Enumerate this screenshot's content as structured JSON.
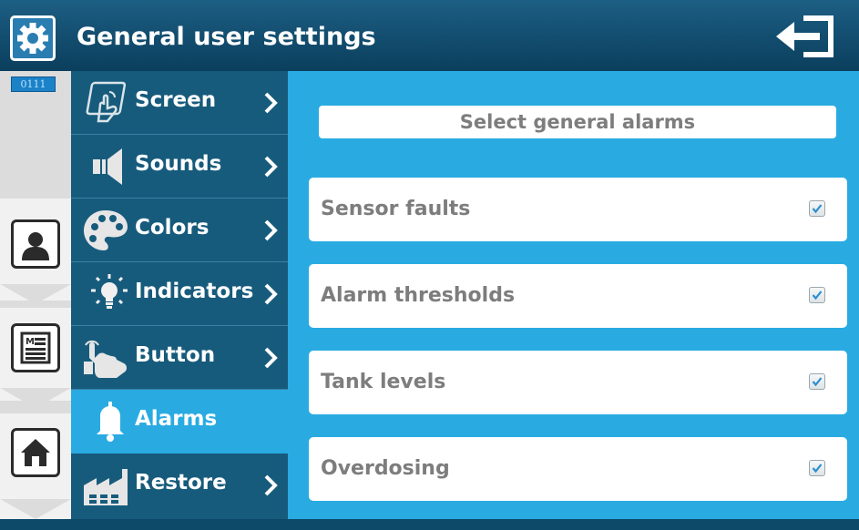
{
  "header": {
    "title": "General user settings",
    "settings_icon": "gear-icon",
    "exit_icon": "exit-icon"
  },
  "sidebar": {
    "badge": "0111",
    "buttons": [
      {
        "name": "user-profile-button",
        "icon": "person-icon"
      },
      {
        "name": "recipe-button",
        "icon": "document-list-icon"
      },
      {
        "name": "home-button",
        "icon": "home-icon"
      }
    ]
  },
  "menu": {
    "items": [
      {
        "label": "Screen",
        "icon": "touch-screen-icon",
        "active": false
      },
      {
        "label": "Sounds",
        "icon": "speaker-icon",
        "active": false
      },
      {
        "label": "Colors",
        "icon": "palette-icon",
        "active": false
      },
      {
        "label": "Indicators",
        "icon": "lightbulb-icon",
        "active": false
      },
      {
        "label": "Button",
        "icon": "hand-press-icon",
        "active": false
      },
      {
        "label": "Alarms",
        "icon": "bell-icon",
        "active": true
      },
      {
        "label": "Restore",
        "icon": "factory-icon",
        "active": false
      }
    ]
  },
  "main": {
    "section_title": "Select general alarms",
    "alarms": [
      {
        "label": "Sensor faults",
        "checked": true
      },
      {
        "label": "Alarm thresholds",
        "checked": true
      },
      {
        "label": "Tank levels",
        "checked": true
      },
      {
        "label": "Overdosing",
        "checked": true
      }
    ]
  },
  "colors": {
    "header_bg": "#134e70",
    "menu_bg": "#175b7c",
    "active_bg": "#29abe2",
    "content_bg": "#29abe2",
    "label_text": "#7d7d7d",
    "check_blue": "#2a8fd0"
  }
}
